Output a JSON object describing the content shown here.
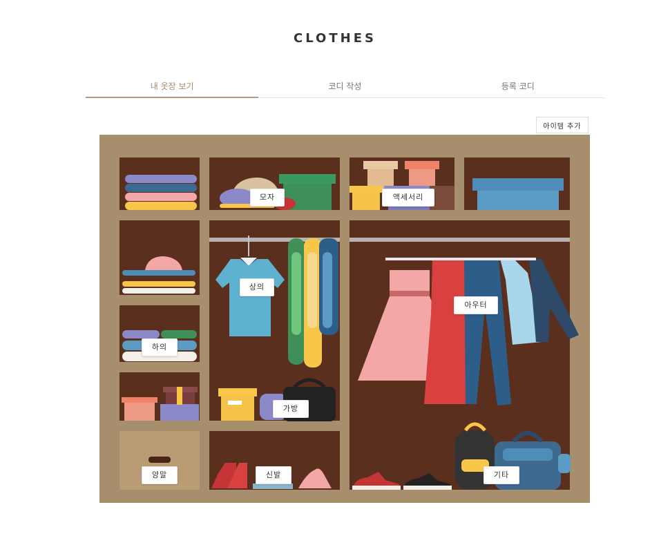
{
  "header": {
    "title": "CLOTHES"
  },
  "tabs": [
    {
      "label": "내 옷장 보기",
      "active": true
    },
    {
      "label": "코디 작성",
      "active": false
    },
    {
      "label": "등록 코디",
      "active": false
    }
  ],
  "toolbar": {
    "add_item_label": "아이템 추가"
  },
  "closet": {
    "categories": {
      "hat": "모자",
      "accessory": "액세서리",
      "top": "상의",
      "outer": "아우터",
      "bottom": "하의",
      "bag": "가방",
      "socks": "양말",
      "shoes": "신발",
      "etc": "기타"
    }
  },
  "colors": {
    "accent": "#b39a7c",
    "closet_frame": "#a78f6e",
    "closet_inside": "#5a2f1d"
  }
}
